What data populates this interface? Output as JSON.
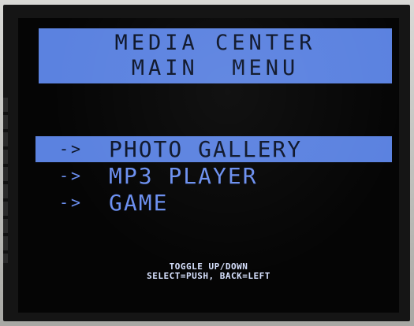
{
  "header": {
    "line1": "MEDIA CENTER",
    "line2": "MAIN  MENU"
  },
  "menu": {
    "items": [
      {
        "arrow": "->",
        "label": "PHOTO GALLERY",
        "selected": true
      },
      {
        "arrow": "->",
        "label": "MP3 PLAYER",
        "selected": false
      },
      {
        "arrow": "->",
        "label": "GAME",
        "selected": false
      }
    ]
  },
  "hints": {
    "line1": "TOGGLE UP/DOWN",
    "line2": "SELECT=PUSH, BACK=LEFT"
  },
  "colors": {
    "highlight": "#5b82e0",
    "text_blue": "#6b8ff0",
    "screen_bg": "#050505"
  }
}
